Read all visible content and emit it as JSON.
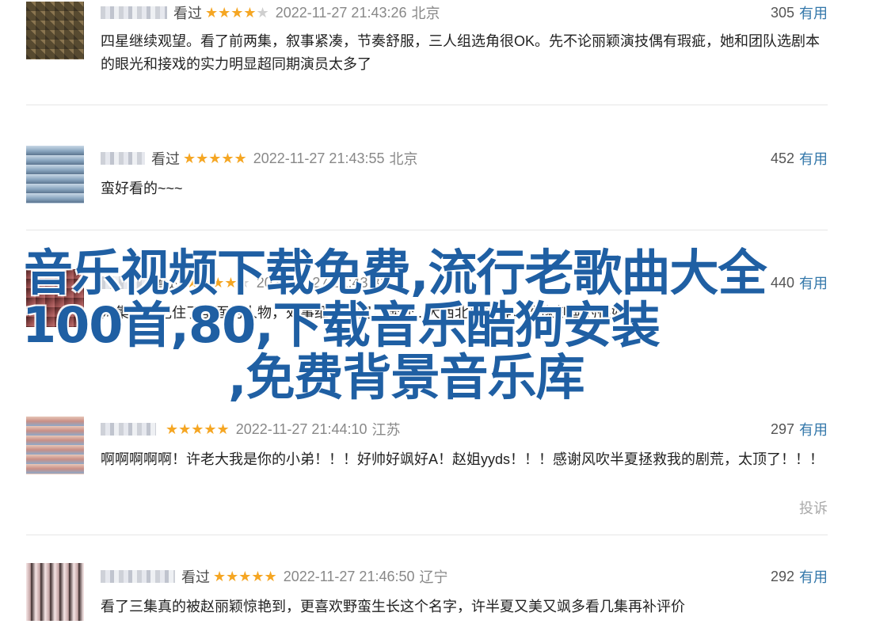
{
  "reviews": [
    {
      "watched": "看过",
      "stars": "★★★★",
      "stars_empty": "★",
      "time": "2022-11-27 21:43:26",
      "location": "北京",
      "count": "305",
      "useful": "有用",
      "text": "四星继续观望。看了前两集，叙事紧凑，节奏舒服，三人组选角很OK。先不论丽颖演技偶有瑕疵，她和团队选剧本的眼光和接戏的实力明显超同期演员太多了"
    },
    {
      "watched": "看过",
      "stars": "★★★★★",
      "stars_empty": "",
      "time": "2022-11-27 21:43:55",
      "location": "北京",
      "count": "452",
      "useful": "有用",
      "text": "蛮好看的~~~"
    },
    {
      "watched": "看过",
      "stars": "★★★★",
      "stars_empty": "★",
      "time": "2022-11-27 21:43:31",
      "location": "",
      "count": "440",
      "useful": "有用",
      "text": "两集基本记住了里面的人物，处事细节丰富，奔赴...大西北建设等，群像刻画的很好"
    },
    {
      "watched": "",
      "stars": "★★★★★",
      "stars_empty": "",
      "time": "2022-11-27 21:44:10",
      "location": "江苏",
      "count": "297",
      "useful": "有用",
      "text": "啊啊啊啊啊！许老大我是你的小弟！！！好帅好飒好A！赵姐yyds！！！感谢风吹半夏拯救我的剧荒，太顶了！！！",
      "report": "投诉"
    },
    {
      "watched": "看过",
      "stars": "★★★★★",
      "stars_empty": "",
      "time": "2022-11-27 21:46:50",
      "location": "辽宁",
      "count": "292",
      "useful": "有用",
      "text": "看了三集真的被赵丽颖惊艳到，更喜欢野蛮生长这个名字，许半夏又美又飒多看几集再补评价"
    }
  ],
  "overlay": {
    "line1": "音乐视频下载免费,流行老歌曲大全",
    "line2": "100首,80,下载音乐酷狗安装",
    "line3": ",免费背景音乐库"
  },
  "colors": {
    "accent": "#3377aa",
    "star": "#f5a623",
    "overlay": "#1f5fa3"
  }
}
